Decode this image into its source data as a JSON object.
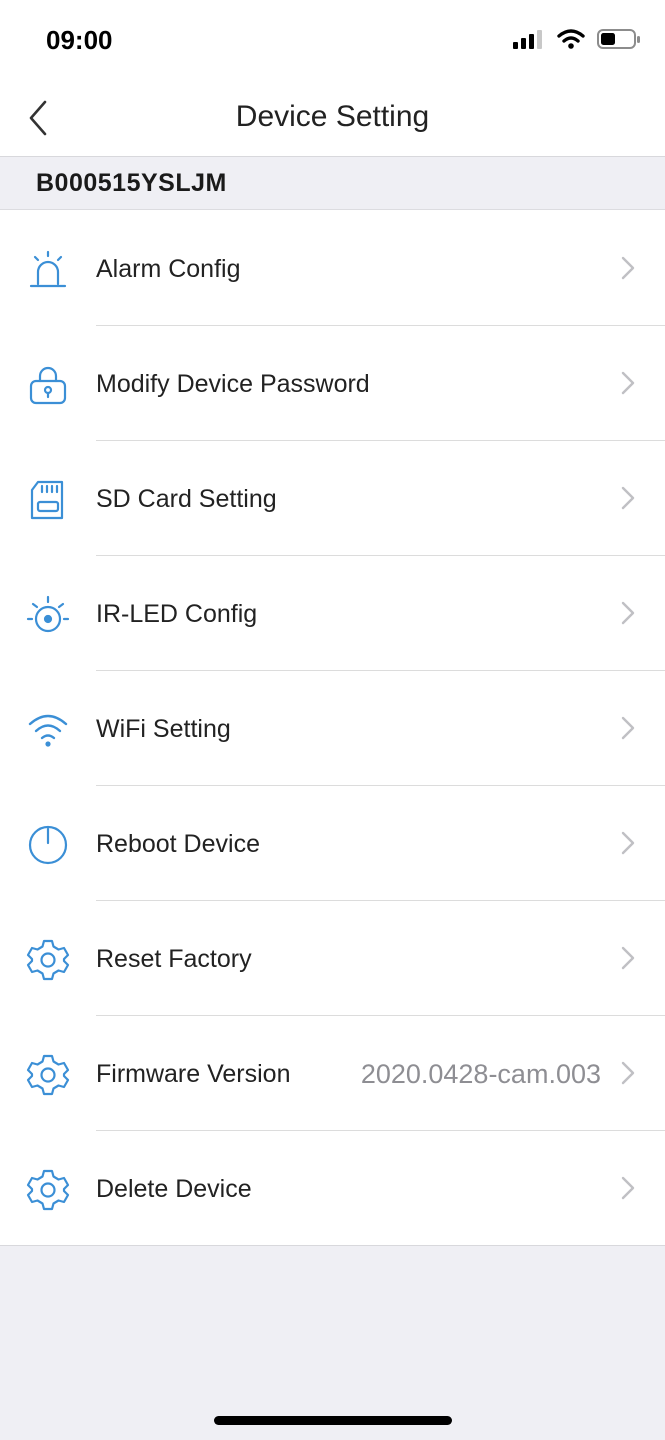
{
  "status_bar": {
    "time": "09:00"
  },
  "nav": {
    "title": "Device Setting"
  },
  "device": {
    "id": "B000515YSLJM"
  },
  "items": [
    {
      "label": "Alarm Config",
      "icon": "alarm-icon"
    },
    {
      "label": "Modify Device Password",
      "icon": "lock-icon"
    },
    {
      "label": "SD Card Setting",
      "icon": "sd-card-icon"
    },
    {
      "label": "IR-LED Config",
      "icon": "ir-led-icon"
    },
    {
      "label": "WiFi Setting",
      "icon": "wifi-icon"
    },
    {
      "label": "Reboot Device",
      "icon": "power-icon"
    },
    {
      "label": "Reset Factory",
      "icon": "gear-icon"
    },
    {
      "label": "Firmware Version",
      "value": "2020.0428-cam.003",
      "icon": "gear-icon"
    },
    {
      "label": "Delete Device",
      "icon": "gear-icon"
    }
  ],
  "colors": {
    "accent": "#3b8fd6",
    "chevron": "#c7c7cc",
    "background": "#efeff4"
  }
}
